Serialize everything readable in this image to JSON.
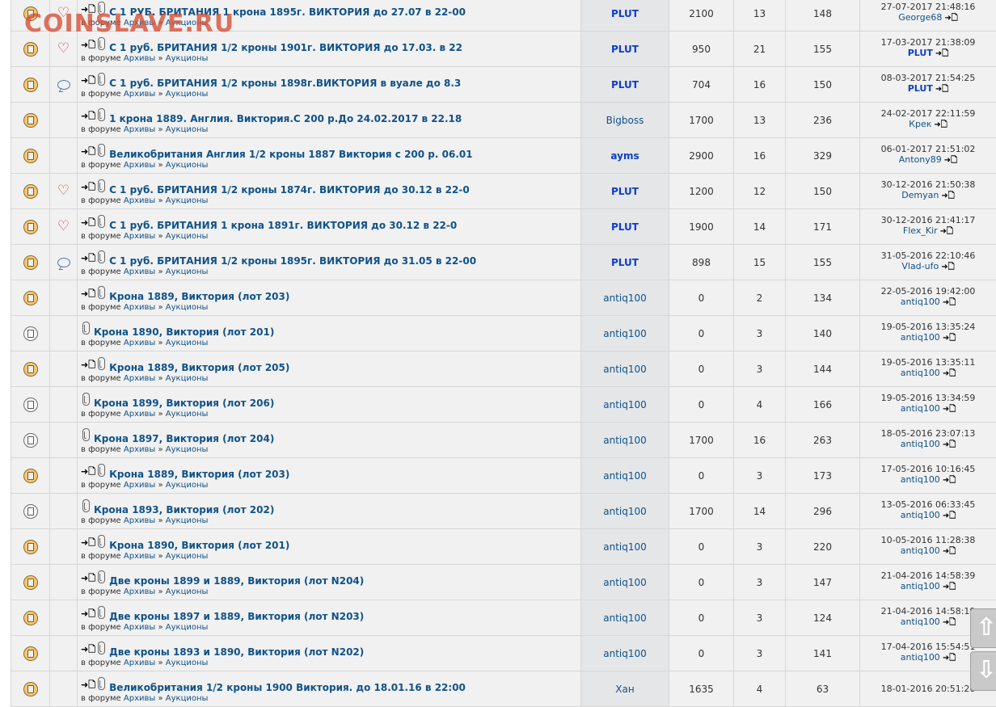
{
  "watermark": "COINSLAVE.RU",
  "forum_prefix": "в форуме",
  "breadcrumb_sep": "»",
  "scroll_up": "⇧",
  "scroll_down": "⇩",
  "rows": [
    {
      "status": "unread",
      "mark": "heart",
      "new": true,
      "title": "С 1 РУБ. БРИТАНИЯ 1 крона 1895г. ВИКТОРИЯ до 27.07 в 22-00",
      "forum": "Архивы",
      "subforum": "Аукционы",
      "author": "PLUT",
      "author_strong": true,
      "price": "2100",
      "replies": "13",
      "views": "148",
      "last_date": "27-07-2017 21:48:16",
      "last_user": "George68",
      "last_strong": false
    },
    {
      "status": "unread",
      "mark": "heart",
      "new": true,
      "title": "С 1 руб. БРИТАНИЯ 1/2 кроны 1901г. ВИКТОРИЯ до 17.03. в 22",
      "forum": "Архивы",
      "subforum": "Аукционы",
      "author": "PLUT",
      "author_strong": true,
      "price": "950",
      "replies": "21",
      "views": "155",
      "last_date": "17-03-2017 21:38:09",
      "last_user": "PLUT",
      "last_strong": true
    },
    {
      "status": "unread",
      "mark": "bubble",
      "new": true,
      "title": "С 1 руб. БРИТАНИЯ 1/2 кроны 1898г.ВИКТОРИЯ в вуале до 8.3",
      "forum": "Архивы",
      "subforum": "Аукционы",
      "author": "PLUT",
      "author_strong": true,
      "price": "704",
      "replies": "16",
      "views": "150",
      "last_date": "08-03-2017 21:54:25",
      "last_user": "PLUT",
      "last_strong": true
    },
    {
      "status": "unread",
      "mark": "",
      "new": true,
      "title": "1 крона 1889. Англия. Виктория.С 200 р.До 24.02.2017 в 22.18",
      "forum": "Архивы",
      "subforum": "Аукционы",
      "author": "Bigboss",
      "author_strong": false,
      "price": "1700",
      "replies": "13",
      "views": "236",
      "last_date": "24-02-2017 22:11:59",
      "last_user": "Крек",
      "last_strong": false
    },
    {
      "status": "unread",
      "mark": "",
      "new": true,
      "title": "Великобритания Англия 1/2 кроны 1887 Виктория с 200 р. 06.01",
      "forum": "Архивы",
      "subforum": "Аукционы",
      "author": "ayms",
      "author_strong": true,
      "price": "2900",
      "replies": "16",
      "views": "329",
      "last_date": "06-01-2017 21:51:02",
      "last_user": "Antony89",
      "last_strong": false
    },
    {
      "status": "unread",
      "mark": "heart",
      "new": true,
      "title": "С 1 руб. БРИТАНИЯ 1/2 кроны 1874г. ВИКТОРИЯ до 30.12 в 22-0",
      "forum": "Архивы",
      "subforum": "Аукционы",
      "author": "PLUT",
      "author_strong": true,
      "price": "1200",
      "replies": "12",
      "views": "150",
      "last_date": "30-12-2016 21:50:38",
      "last_user": "Demyan",
      "last_strong": false
    },
    {
      "status": "unread",
      "mark": "heart",
      "new": true,
      "title": "С 1 руб. БРИТАНИЯ 1 крона 1891г. ВИКТОРИЯ до 30.12 в 22-0",
      "forum": "Архивы",
      "subforum": "Аукционы",
      "author": "PLUT",
      "author_strong": true,
      "price": "1900",
      "replies": "14",
      "views": "171",
      "last_date": "30-12-2016 21:41:17",
      "last_user": "Flex_Kir",
      "last_strong": false
    },
    {
      "status": "unread",
      "mark": "bubble",
      "new": true,
      "title": "С 1 руб. БРИТАНИЯ 1/2 кроны 1895г. ВИКТОРИЯ до 31.05 в 22-00",
      "forum": "Архивы",
      "subforum": "Аукционы",
      "author": "PLUT",
      "author_strong": true,
      "price": "898",
      "replies": "15",
      "views": "155",
      "last_date": "31-05-2016 22:10:46",
      "last_user": "Vlad-ufo",
      "last_strong": false
    },
    {
      "status": "unread",
      "mark": "",
      "new": true,
      "title": "Крона 1889, Виктория (лот 203)",
      "forum": "Архивы",
      "subforum": "Аукционы",
      "author": "antiq100",
      "author_strong": false,
      "price": "0",
      "replies": "2",
      "views": "134",
      "last_date": "22-05-2016 19:42:00",
      "last_user": "antiq100",
      "last_strong": false
    },
    {
      "status": "read",
      "mark": "",
      "new": false,
      "title": "Крона 1890, Виктория (лот 201)",
      "forum": "Архивы",
      "subforum": "Аукционы",
      "author": "antiq100",
      "author_strong": false,
      "price": "0",
      "replies": "3",
      "views": "140",
      "last_date": "19-05-2016 13:35:24",
      "last_user": "antiq100",
      "last_strong": false
    },
    {
      "status": "unread",
      "mark": "",
      "new": true,
      "title": "Крона 1889, Виктория (лот 205)",
      "forum": "Архивы",
      "subforum": "Аукционы",
      "author": "antiq100",
      "author_strong": false,
      "price": "0",
      "replies": "3",
      "views": "144",
      "last_date": "19-05-2016 13:35:11",
      "last_user": "antiq100",
      "last_strong": false
    },
    {
      "status": "read",
      "mark": "",
      "new": false,
      "title": "Крона 1899, Виктория (лот 206)",
      "forum": "Архивы",
      "subforum": "Аукционы",
      "author": "antiq100",
      "author_strong": false,
      "price": "0",
      "replies": "4",
      "views": "166",
      "last_date": "19-05-2016 13:34:59",
      "last_user": "antiq100",
      "last_strong": false
    },
    {
      "status": "read",
      "mark": "",
      "new": false,
      "title": "Крона 1897, Виктория (лот 204)",
      "forum": "Архивы",
      "subforum": "Аукционы",
      "author": "antiq100",
      "author_strong": false,
      "price": "1700",
      "replies": "16",
      "views": "263",
      "last_date": "18-05-2016 23:07:13",
      "last_user": "antiq100",
      "last_strong": false
    },
    {
      "status": "unread",
      "mark": "",
      "new": true,
      "title": "Крона 1889, Виктория (лот 203)",
      "forum": "Архивы",
      "subforum": "Аукционы",
      "author": "antiq100",
      "author_strong": false,
      "price": "0",
      "replies": "3",
      "views": "173",
      "last_date": "17-05-2016 10:16:45",
      "last_user": "antiq100",
      "last_strong": false
    },
    {
      "status": "read",
      "mark": "",
      "new": false,
      "title": "Крона 1893, Виктория (лот 202)",
      "forum": "Архивы",
      "subforum": "Аукционы",
      "author": "antiq100",
      "author_strong": false,
      "price": "1700",
      "replies": "14",
      "views": "296",
      "last_date": "13-05-2016 06:33:45",
      "last_user": "antiq100",
      "last_strong": false
    },
    {
      "status": "unread",
      "mark": "",
      "new": true,
      "title": "Крона 1890, Виктория (лот 201)",
      "forum": "Архивы",
      "subforum": "Аукционы",
      "author": "antiq100",
      "author_strong": false,
      "price": "0",
      "replies": "3",
      "views": "220",
      "last_date": "10-05-2016 11:28:38",
      "last_user": "antiq100",
      "last_strong": false
    },
    {
      "status": "unread",
      "mark": "",
      "new": true,
      "title": "Две кроны 1899 и 1889, Виктория (лот N204)",
      "forum": "Архивы",
      "subforum": "Аукционы",
      "author": "antiq100",
      "author_strong": false,
      "price": "0",
      "replies": "3",
      "views": "147",
      "last_date": "21-04-2016 14:58:39",
      "last_user": "antiq100",
      "last_strong": false
    },
    {
      "status": "unread",
      "mark": "",
      "new": true,
      "title": "Две кроны 1897 и 1889, Виктория (лот N203)",
      "forum": "Архивы",
      "subforum": "Аукционы",
      "author": "antiq100",
      "author_strong": false,
      "price": "0",
      "replies": "3",
      "views": "124",
      "last_date": "21-04-2016 14:58:19",
      "last_user": "antiq100",
      "last_strong": false
    },
    {
      "status": "unread",
      "mark": "",
      "new": true,
      "title": "Две кроны 1893 и 1890, Виктория (лот N202)",
      "forum": "Архивы",
      "subforum": "Аукционы",
      "author": "antiq100",
      "author_strong": false,
      "price": "0",
      "replies": "3",
      "views": "141",
      "last_date": "17-04-2016 15:54:51",
      "last_user": "antiq100",
      "last_strong": false
    },
    {
      "status": "unread",
      "mark": "",
      "new": true,
      "title": "Великобритания 1/2 кроны 1900 Виктория. до 18.01.16 в 22:00",
      "forum": "Архивы",
      "subforum": "Аукционы",
      "author": "Хан",
      "author_strong": false,
      "price": "1635",
      "replies": "4",
      "views": "63",
      "last_date": "18-01-2016 20:51:26",
      "last_user": "",
      "last_strong": false
    }
  ]
}
